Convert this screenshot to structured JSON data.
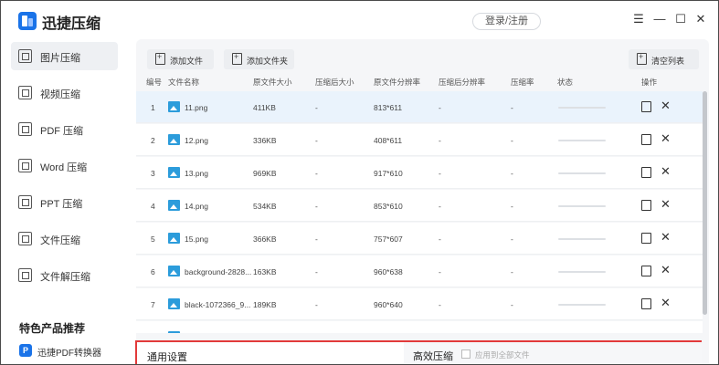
{
  "app": {
    "title": "迅捷压缩",
    "login": "登录/注册"
  },
  "window_controls": {
    "menu": "☰",
    "minimize": "—",
    "maximize": "☐",
    "close": "✕"
  },
  "sidebar": {
    "items": [
      {
        "label": "图片压缩",
        "active": true
      },
      {
        "label": "视频压缩"
      },
      {
        "label": "PDF 压缩"
      },
      {
        "label": "Word 压缩"
      },
      {
        "label": "PPT 压缩"
      },
      {
        "label": "文件压缩"
      },
      {
        "label": "文件解压缩"
      }
    ],
    "recommend_title": "特色产品推荐",
    "recommend_item": {
      "icon": "P",
      "label": "迅捷PDF转换器"
    }
  },
  "toolbar": {
    "add_file": "添加文件",
    "add_folder": "添加文件夹",
    "clear_list": "清空列表"
  },
  "table": {
    "headers": [
      "编号",
      "文件名称",
      "原文件大小",
      "压缩后大小",
      "原文件分辨率",
      "压缩后分辨率",
      "压缩率",
      "状态",
      "操作"
    ],
    "rows": [
      {
        "no": "1",
        "name": "11.png",
        "size": "411KB",
        "csize": "-",
        "res": "813*611",
        "cres": "-",
        "rate": "-"
      },
      {
        "no": "2",
        "name": "12.png",
        "size": "336KB",
        "csize": "-",
        "res": "408*611",
        "cres": "-",
        "rate": "-"
      },
      {
        "no": "3",
        "name": "13.png",
        "size": "969KB",
        "csize": "-",
        "res": "917*610",
        "cres": "-",
        "rate": "-"
      },
      {
        "no": "4",
        "name": "14.png",
        "size": "534KB",
        "csize": "-",
        "res": "853*610",
        "cres": "-",
        "rate": "-"
      },
      {
        "no": "5",
        "name": "15.png",
        "size": "366KB",
        "csize": "-",
        "res": "757*607",
        "cres": "-",
        "rate": "-"
      },
      {
        "no": "6",
        "name": "background-2828...",
        "size": "163KB",
        "csize": "-",
        "res": "960*638",
        "cres": "-",
        "rate": "-"
      },
      {
        "no": "7",
        "name": "black-1072366_9...",
        "size": "189KB",
        "csize": "-",
        "res": "960*640",
        "cres": "-",
        "rate": "-"
      }
    ]
  },
  "settings": {
    "general_title": "通用设置",
    "hq_title": "高效压缩",
    "apply_all": "应用到全部文件"
  },
  "colors": {
    "accent": "#1a73e8",
    "selected_row": "#eaf3fc",
    "highlight_border": "#e23a3a"
  }
}
